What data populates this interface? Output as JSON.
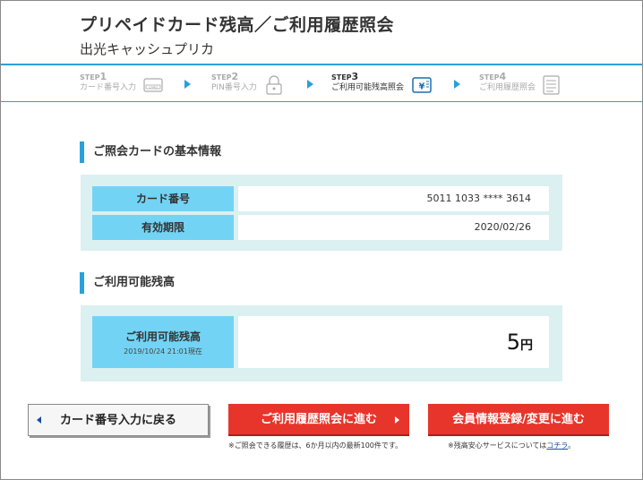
{
  "header": {
    "title": "プリペイドカード残高／ご利用履歴照会",
    "subtitle": "出光キャッシュプリカ"
  },
  "steps": [
    {
      "num_prefix": "STEP",
      "num": "1",
      "label": "カード番号入力",
      "icon": "card-icon",
      "active": false
    },
    {
      "num_prefix": "STEP",
      "num": "2",
      "label": "PIN番号入力",
      "icon": "lock-icon",
      "active": false
    },
    {
      "num_prefix": "STEP",
      "num": "3",
      "label": "ご利用可能残高照会",
      "icon": "yen-icon",
      "active": true
    },
    {
      "num_prefix": "STEP",
      "num": "4",
      "label": "ご利用履歴照会",
      "icon": "list-icon",
      "active": false
    }
  ],
  "card_info": {
    "heading": "ご照会カードの基本情報",
    "card_number_label": "カード番号",
    "card_number_value": "5011 1033 **** 3614",
    "expiry_label": "有効期限",
    "expiry_value": "2020/02/26"
  },
  "balance": {
    "heading": "ご利用可能残高",
    "label": "ご利用可能残高",
    "timestamp": "2019/10/24 21:01現在",
    "amount": "5",
    "unit": "円"
  },
  "buttons": {
    "back_label": "カード番号入力に戻る",
    "history_label": "ご利用履歴照会に進む",
    "member_label": "会員情報登録/変更に進む"
  },
  "notes": {
    "history_note": "※ご照会できる履歴は、6か月以内の最新100件です。",
    "member_note_prefix": "※残高安心サービスについては",
    "member_note_link": "コチラ",
    "member_note_suffix": "。"
  },
  "colors": {
    "accent_blue": "#2aa0db",
    "label_cyan": "#73d3f4",
    "panel_bg": "#dbf0f0",
    "button_red": "#e8352b"
  }
}
